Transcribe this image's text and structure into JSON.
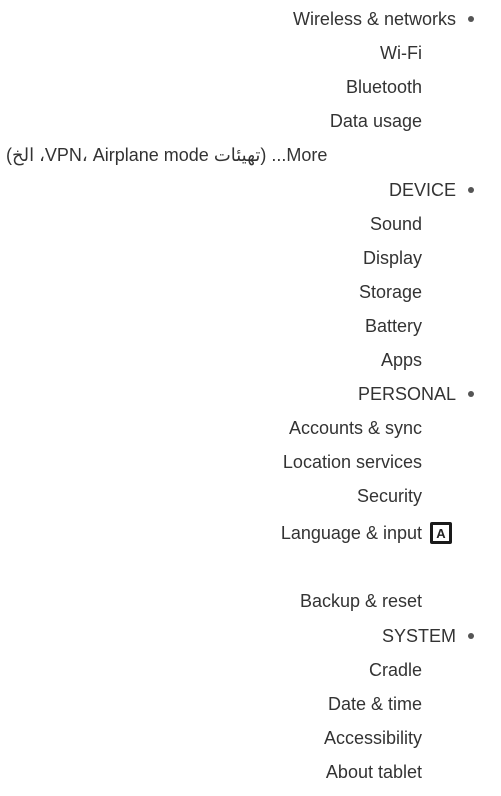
{
  "sections": {
    "wireless": {
      "title": "Wireless & networks",
      "items": [
        "Wi-Fi",
        "Bluetooth",
        "Data usage",
        "More... (تهيئات VPN، Airplane mode، الخ)"
      ]
    },
    "device": {
      "title": "DEVICE",
      "items": [
        "Sound",
        "Display",
        "Storage",
        "Battery",
        "Apps"
      ]
    },
    "personal": {
      "title": "PERSONAL",
      "items": [
        "Accounts & sync",
        "Location services",
        "Security",
        "Language & input",
        "Backup & reset"
      ],
      "language_icon_letter": "A"
    },
    "system": {
      "title": "SYSTEM",
      "items": [
        "Cradle",
        "Date & time",
        "Accessibility",
        "About tablet"
      ]
    }
  }
}
